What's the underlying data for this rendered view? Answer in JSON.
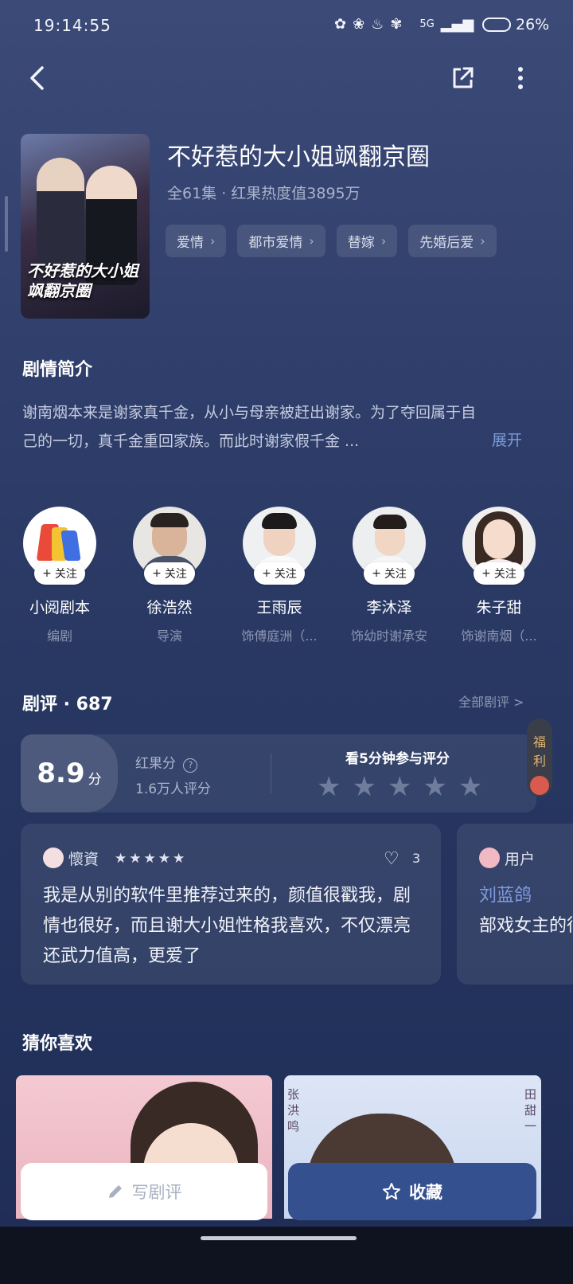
{
  "status_bar": {
    "time": "19:14:55",
    "network": "5G",
    "battery": "26%"
  },
  "drama": {
    "title": "不好惹的大小姐飒翻京圈",
    "meta": "全61集 · 红果热度值3895万",
    "poster_title": "不好惹的大小姐飒翻京圈",
    "tags": [
      "爱情",
      "都市爱情",
      "替嫁",
      "先婚后爱"
    ]
  },
  "synopsis": {
    "heading": "剧情简介",
    "text": "谢南烟本来是谢家真千金，从小与母亲被赶出谢家。为了夺回属于自己的一切，真千金重回家族。而此时谢家假千金 ...",
    "expand_label": "展开"
  },
  "cast": [
    {
      "name": "小阅剧本",
      "role": "编剧",
      "follow_label": "关注"
    },
    {
      "name": "徐浩然",
      "role": "导演",
      "follow_label": "关注"
    },
    {
      "name": "王雨辰",
      "role": "饰傅庭洲（...",
      "follow_label": "关注"
    },
    {
      "name": "李沐泽",
      "role": "饰幼时谢承安",
      "follow_label": "关注"
    },
    {
      "name": "朱子甜",
      "role": "饰谢南烟（...",
      "follow_label": "关注"
    }
  ],
  "reviews": {
    "heading": "剧评 · 687",
    "all_label": "全部剧评 >",
    "score": "8.9",
    "score_unit": "分",
    "score_label": "红果分",
    "score_count": "1.6万人评分",
    "rate_prompt": "看5分钟参与评分",
    "welfare": [
      "福",
      "利"
    ],
    "items": [
      {
        "user": "懷資",
        "likes": "3",
        "text": "我是从别的软件里推荐过来的，颜值很戳我，剧情也很好，而且谢大小姐性格我喜欢，不仅漂亮还武力值高，更爱了"
      },
      {
        "user": "用户",
        "mention": "刘蓝鸽",
        "text": "部戏女主的很爽。"
      }
    ]
  },
  "recommend": {
    "heading": "猜你喜欢",
    "card2_vertical_left": "张洪鸣",
    "card2_vertical_right": "田甜一"
  },
  "actions": {
    "write_review": "写剧评",
    "favorite": "收藏"
  },
  "colors": {
    "accent": "#35508f",
    "link": "#7e9bdc"
  }
}
